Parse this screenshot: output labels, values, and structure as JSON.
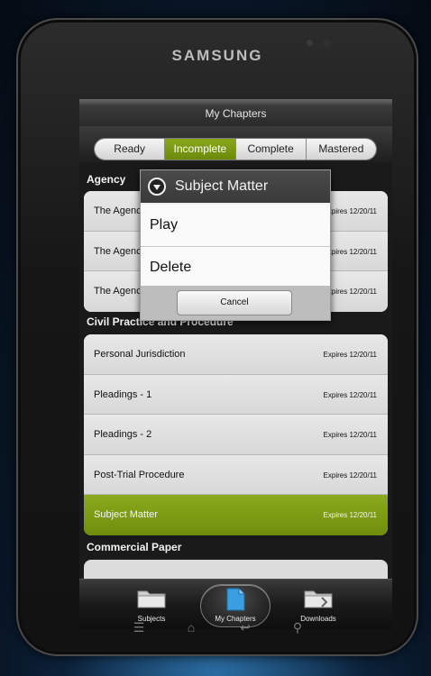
{
  "device": {
    "brand": "SAMSUNG"
  },
  "header": {
    "title": "My Chapters"
  },
  "filter_tabs": [
    {
      "label": "Ready",
      "active": false
    },
    {
      "label": "Incomplete",
      "active": true
    },
    {
      "label": "Complete",
      "active": false
    },
    {
      "label": "Mastered",
      "active": false
    }
  ],
  "sections": [
    {
      "title": "Agency",
      "items": [
        {
          "name": "The Agency",
          "expires": "Expires 12/20/11"
        },
        {
          "name": "The Agency",
          "expires": "Expires 12/20/11"
        },
        {
          "name": "The Agency",
          "expires": "Expires 12/20/11"
        }
      ]
    },
    {
      "title": "Civil Practice and Procedure",
      "items": [
        {
          "name": "Personal Jurisdiction",
          "expires": "Expires 12/20/11"
        },
        {
          "name": "Pleadings - 1",
          "expires": "Expires 12/20/11"
        },
        {
          "name": "Pleadings - 2",
          "expires": "Expires 12/20/11"
        },
        {
          "name": "Post-Trial Procedure",
          "expires": "Expires 12/20/11"
        },
        {
          "name": "Subject Matter",
          "expires": "Expires 12/20/11"
        }
      ]
    },
    {
      "title": "Commercial Paper",
      "items": []
    }
  ],
  "dialog": {
    "title": "Subject Matter",
    "options": [
      "Play",
      "Delete"
    ],
    "cancel": "Cancel"
  },
  "tabbar": [
    {
      "label": "Subjects",
      "icon": "folder-icon"
    },
    {
      "label": "My Chapters",
      "icon": "document-icon"
    },
    {
      "label": "Downloads",
      "icon": "download-folder-icon"
    }
  ],
  "colors": {
    "accent_green": "#7a9a12",
    "screen_bg": "#1a1a1a"
  }
}
